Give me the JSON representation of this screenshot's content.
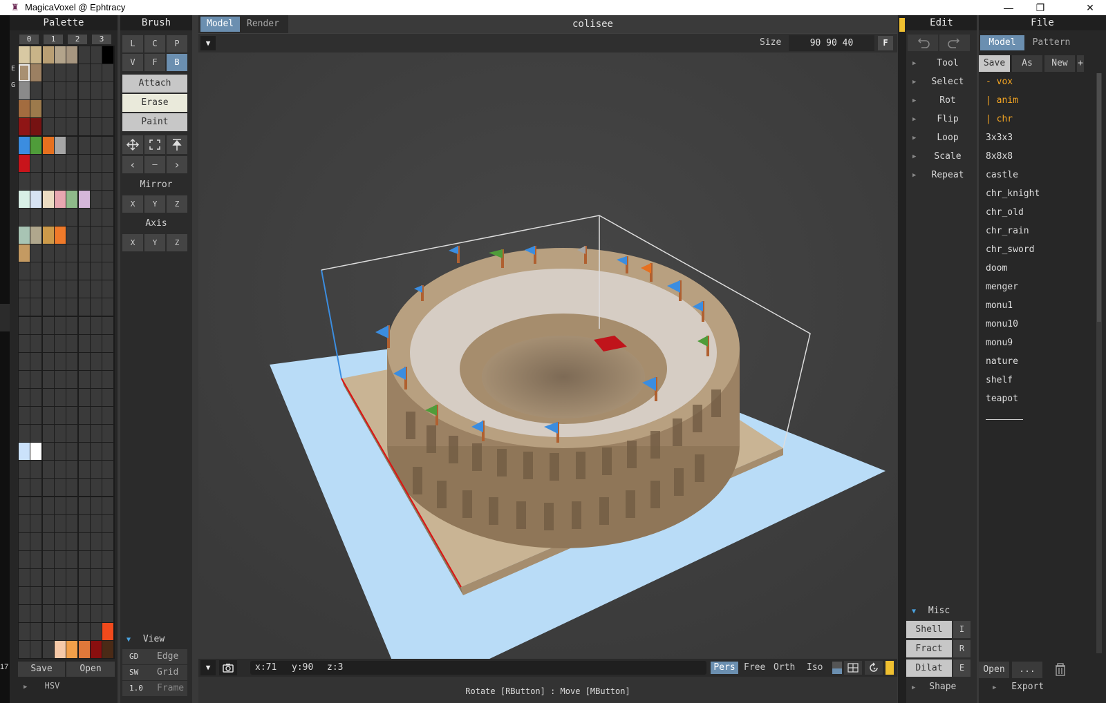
{
  "window": {
    "title": "MagicaVoxel @ Ephtracy",
    "controls": [
      "—",
      "❐",
      "✕"
    ]
  },
  "taskbar": {
    "number": "17"
  },
  "palette": {
    "title": "Palette",
    "columns": [
      "0",
      "1",
      "2",
      "3"
    ],
    "side_labels": [
      "E",
      "G"
    ],
    "save_label": "Save",
    "open_label": "Open",
    "hsv_label": "HSV",
    "colors": [
      [
        "#d8c9a3",
        "#c9b488",
        "#b99f74",
        "#b3a48b",
        "#a79680",
        "#3a3a3a",
        "#3a3a3a",
        "#000000"
      ],
      [
        "#a89072",
        "#9c8062",
        "#3a3a3a",
        "#3a3a3a",
        "#3a3a3a",
        "#3a3a3a",
        "#3a3a3a",
        "#3a3a3a"
      ],
      [
        "#8a8a8a",
        "#3a3a3a",
        "#3a3a3a",
        "#3a3a3a",
        "#3a3a3a",
        "#3a3a3a",
        "#3a3a3a",
        "#3a3a3a"
      ],
      [
        "#a36c3f",
        "#9c7a4c",
        "#3a3a3a",
        "#3a3a3a",
        "#3a3a3a",
        "#3a3a3a",
        "#3a3a3a",
        "#3a3a3a"
      ],
      [
        "#8f1515",
        "#761212",
        "#3a3a3a",
        "#3a3a3a",
        "#3a3a3a",
        "#3a3a3a",
        "#3a3a3a",
        "#3a3a3a"
      ],
      [
        "#3b8de0",
        "#4f9c3a",
        "#e6701f",
        "#a6a6a6",
        "#3a3a3a",
        "#3a3a3a",
        "#3a3a3a",
        "#3a3a3a"
      ],
      [
        "#c8141b",
        "#3a3a3a",
        "#3a3a3a",
        "#3a3a3a",
        "#3a3a3a",
        "#3a3a3a",
        "#3a3a3a",
        "#3a3a3a"
      ],
      [
        "#3a3a3a",
        "#3a3a3a",
        "#3a3a3a",
        "#3a3a3a",
        "#3a3a3a",
        "#3a3a3a",
        "#3a3a3a",
        "#3a3a3a"
      ],
      [
        "#d8efe6",
        "#d6e2f2",
        "#ecdcc2",
        "#e8a7b0",
        "#8fba8a",
        "#d5b7d9",
        "#3a3a3a",
        "#3a3a3a"
      ],
      [
        "#3a3a3a",
        "#3a3a3a",
        "#3a3a3a",
        "#3a3a3a",
        "#3a3a3a",
        "#3a3a3a",
        "#3a3a3a",
        "#3a3a3a"
      ],
      [
        "#a8c4b4",
        "#b0a78d",
        "#cc9a4a",
        "#f07a2a",
        "#3a3a3a",
        "#3a3a3a",
        "#3a3a3a",
        "#3a3a3a"
      ],
      [
        "#c49a62",
        "#3a3a3a",
        "#3a3a3a",
        "#3a3a3a",
        "#3a3a3a",
        "#3a3a3a",
        "#3a3a3a",
        "#3a3a3a"
      ],
      [
        "#3a3a3a",
        "#3a3a3a",
        "#3a3a3a",
        "#3a3a3a",
        "#3a3a3a",
        "#3a3a3a",
        "#3a3a3a",
        "#3a3a3a"
      ],
      [
        "#3a3a3a",
        "#3a3a3a",
        "#3a3a3a",
        "#3a3a3a",
        "#3a3a3a",
        "#3a3a3a",
        "#3a3a3a",
        "#3a3a3a"
      ],
      [
        "#3a3a3a",
        "#3a3a3a",
        "#3a3a3a",
        "#3a3a3a",
        "#3a3a3a",
        "#3a3a3a",
        "#3a3a3a",
        "#3a3a3a"
      ],
      [
        "#3a3a3a",
        "#3a3a3a",
        "#3a3a3a",
        "#3a3a3a",
        "#3a3a3a",
        "#3a3a3a",
        "#3a3a3a",
        "#3a3a3a"
      ],
      [
        "#3a3a3a",
        "#3a3a3a",
        "#3a3a3a",
        "#3a3a3a",
        "#3a3a3a",
        "#3a3a3a",
        "#3a3a3a",
        "#3a3a3a"
      ],
      [
        "#3a3a3a",
        "#3a3a3a",
        "#3a3a3a",
        "#3a3a3a",
        "#3a3a3a",
        "#3a3a3a",
        "#3a3a3a",
        "#3a3a3a"
      ],
      [
        "#3a3a3a",
        "#3a3a3a",
        "#3a3a3a",
        "#3a3a3a",
        "#3a3a3a",
        "#3a3a3a",
        "#3a3a3a",
        "#3a3a3a"
      ],
      [
        "#3a3a3a",
        "#3a3a3a",
        "#3a3a3a",
        "#3a3a3a",
        "#3a3a3a",
        "#3a3a3a",
        "#3a3a3a",
        "#3a3a3a"
      ],
      [
        "#3a3a3a",
        "#3a3a3a",
        "#3a3a3a",
        "#3a3a3a",
        "#3a3a3a",
        "#3a3a3a",
        "#3a3a3a",
        "#3a3a3a"
      ],
      [
        "#3a3a3a",
        "#3a3a3a",
        "#3a3a3a",
        "#3a3a3a",
        "#3a3a3a",
        "#3a3a3a",
        "#3a3a3a",
        "#3a3a3a"
      ],
      [
        "#cbe2fb",
        "#ffffff",
        "#3a3a3a",
        "#3a3a3a",
        "#3a3a3a",
        "#3a3a3a",
        "#3a3a3a",
        "#3a3a3a"
      ],
      [
        "#3a3a3a",
        "#3a3a3a",
        "#3a3a3a",
        "#3a3a3a",
        "#3a3a3a",
        "#3a3a3a",
        "#3a3a3a",
        "#3a3a3a"
      ],
      [
        "#3a3a3a",
        "#3a3a3a",
        "#3a3a3a",
        "#3a3a3a",
        "#3a3a3a",
        "#3a3a3a",
        "#3a3a3a",
        "#3a3a3a"
      ],
      [
        "#3a3a3a",
        "#3a3a3a",
        "#3a3a3a",
        "#3a3a3a",
        "#3a3a3a",
        "#3a3a3a",
        "#3a3a3a",
        "#3a3a3a"
      ],
      [
        "#3a3a3a",
        "#3a3a3a",
        "#3a3a3a",
        "#3a3a3a",
        "#3a3a3a",
        "#3a3a3a",
        "#3a3a3a",
        "#3a3a3a"
      ],
      [
        "#3a3a3a",
        "#3a3a3a",
        "#3a3a3a",
        "#3a3a3a",
        "#3a3a3a",
        "#3a3a3a",
        "#3a3a3a",
        "#3a3a3a"
      ],
      [
        "#3a3a3a",
        "#3a3a3a",
        "#3a3a3a",
        "#3a3a3a",
        "#3a3a3a",
        "#3a3a3a",
        "#3a3a3a",
        "#3a3a3a"
      ],
      [
        "#3a3a3a",
        "#3a3a3a",
        "#3a3a3a",
        "#3a3a3a",
        "#3a3a3a",
        "#3a3a3a",
        "#3a3a3a",
        "#3a3a3a"
      ],
      [
        "#3a3a3a",
        "#3a3a3a",
        "#3a3a3a",
        "#3a3a3a",
        "#3a3a3a",
        "#3a3a3a",
        "#3a3a3a",
        "#3a3a3a"
      ],
      [
        "#3a3a3a",
        "#3a3a3a",
        "#3a3a3a",
        "#3a3a3a",
        "#3a3a3a",
        "#3a3a3a",
        "#3a3a3a",
        "#3a3a3a"
      ],
      [
        "#3a3a3a",
        "#3a3a3a",
        "#3a3a3a",
        "#3a3a3a",
        "#3a3a3a",
        "#3a3a3a",
        "#3a3a3a",
        "#f14a1c"
      ],
      [
        "#3a3a3a",
        "#3a3a3a",
        "#3a3a3a",
        "#f6c9a8",
        "#f3a04a",
        "#e0783a",
        "#8a0f0f",
        "#4a2a16"
      ]
    ],
    "selected_color": "#a89072"
  },
  "brush": {
    "title": "Brush",
    "shape_row1": [
      "L",
      "C",
      "P"
    ],
    "shape_row2": [
      "V",
      "F",
      "B"
    ],
    "active_shape": "B",
    "modes": [
      "Attach",
      "Erase",
      "Paint"
    ],
    "active_mode": "Erase",
    "tool_icons": [
      "move-icon",
      "select-box-icon",
      "upload-icon"
    ],
    "nav_icons": [
      "‹",
      "—",
      "›"
    ],
    "mirror_label": "Mirror",
    "mirror_axes": [
      "X",
      "Y",
      "Z"
    ],
    "axis_label": "Axis",
    "axis_axes": [
      "X",
      "Y",
      "Z"
    ],
    "view_label": "View",
    "view_rows": [
      {
        "key": "GD",
        "label": "Edge"
      },
      {
        "key": "SW",
        "label": "Grid"
      },
      {
        "key": "1.0",
        "label": "Frame"
      }
    ]
  },
  "viewport": {
    "tab_model": "Model",
    "tab_render": "Render",
    "active_tab": "Model",
    "filename": "colisee",
    "size_label": "Size",
    "size_value": "90 90 40",
    "fit_button": "F",
    "coords": {
      "x": "x:71",
      "y": "y:90",
      "z": "z:3"
    },
    "projection_modes": [
      "Pers",
      "Free",
      "Orth",
      "Iso"
    ],
    "active_projection": "Pers",
    "status_hint": "Rotate [RButton] : Move [MButton]"
  },
  "edit": {
    "title": "Edit",
    "undo_icon": "undo-icon",
    "redo_icon": "redo-icon",
    "items": [
      "Tool",
      "Select",
      "Rot",
      "Flip",
      "Loop",
      "Scale",
      "Repeat"
    ],
    "misc_label": "Misc",
    "misc_buttons": [
      {
        "label": "Shell",
        "key": "I"
      },
      {
        "label": "Fract",
        "key": "R"
      },
      {
        "label": "Dilat",
        "key": "E"
      }
    ],
    "shape_label": "Shape"
  },
  "file": {
    "title": "File",
    "tab_model": "Model",
    "tab_pattern": "Pattern",
    "save_label": "Save",
    "as_label": "As",
    "new_label": "New",
    "plus_label": "+",
    "folders": [
      "- vox",
      "| anim",
      "| chr"
    ],
    "files": [
      "3x3x3",
      "8x8x8",
      "castle",
      "chr_knight",
      "chr_old",
      "chr_rain",
      "chr_sword",
      "doom",
      "menger",
      "monu1",
      "monu10",
      "monu9",
      "nature",
      "shelf",
      "teapot"
    ],
    "open_label": "Open",
    "more_label": "...",
    "export_label": "Export"
  },
  "theme": {
    "accent": "#6b8fb0",
    "folder_color": "#f5a623",
    "ground": "#b9dcf7"
  }
}
